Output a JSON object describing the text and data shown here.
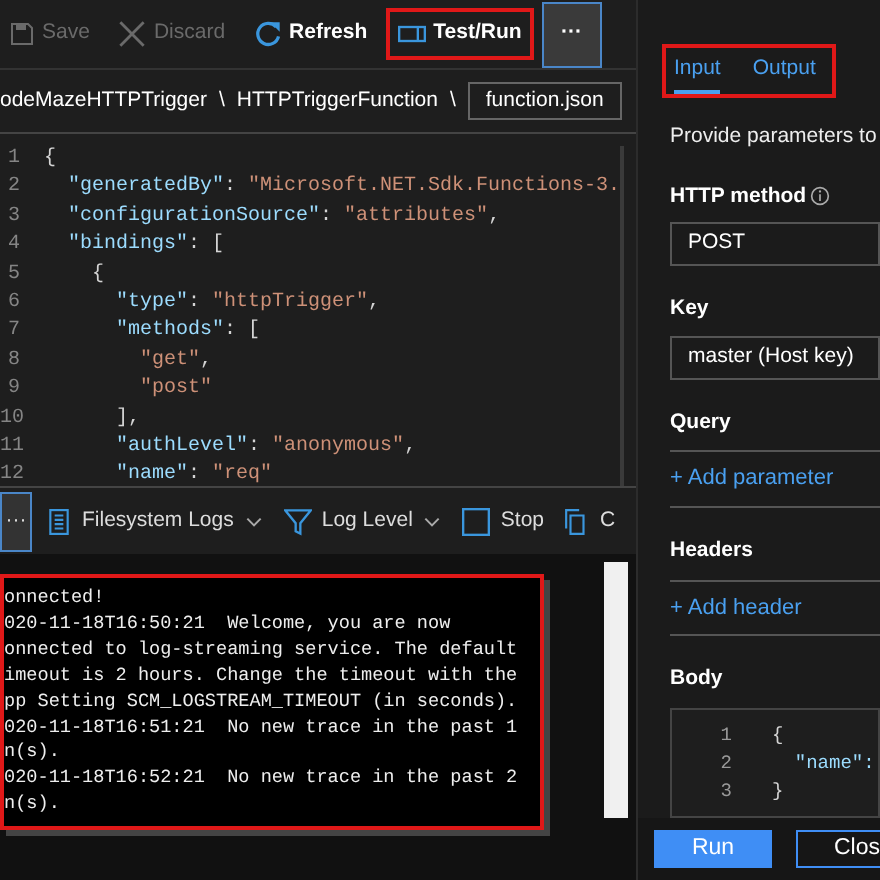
{
  "toolbar": [
    {
      "kind": "save",
      "label": "Save",
      "disabled": true,
      "highlighted": false
    },
    {
      "kind": "discard",
      "label": "Discard",
      "disabled": true,
      "highlighted": false
    },
    {
      "kind": "refresh",
      "label": "Refresh",
      "disabled": false,
      "highlighted": false
    },
    {
      "kind": "testrun",
      "label": "Test/Run",
      "disabled": false,
      "highlighted": true
    },
    {
      "kind": "more",
      "label": "···",
      "disabled": false,
      "highlighted": false,
      "focused": true
    }
  ],
  "breadcrumb": [
    {
      "kind": "segment",
      "text": "odeMazeHTTPTrigger"
    },
    {
      "kind": "separator",
      "text": "\\"
    },
    {
      "kind": "segment",
      "text": "HTTPTriggerFunction"
    },
    {
      "kind": "separator",
      "text": "\\"
    },
    {
      "kind": "file",
      "text": "function.json"
    }
  ],
  "editor": {
    "lines": [
      {
        "number": "1",
        "tokens": [
          {
            "kind": "punct",
            "text": "{"
          }
        ]
      },
      {
        "number": "2",
        "tokens": [
          {
            "kind": "key",
            "text": "  \"generatedBy\""
          },
          {
            "kind": "punct",
            "text": ": "
          },
          {
            "kind": "string",
            "text": "\"Microsoft.NET.Sdk.Functions-3."
          }
        ]
      },
      {
        "number": "3",
        "tokens": [
          {
            "kind": "key",
            "text": "  \"configurationSource\""
          },
          {
            "kind": "punct",
            "text": ": "
          },
          {
            "kind": "string",
            "text": "\"attributes\""
          },
          {
            "kind": "punct",
            "text": ","
          }
        ]
      },
      {
        "number": "4",
        "tokens": [
          {
            "kind": "key",
            "text": "  \"bindings\""
          },
          {
            "kind": "punct",
            "text": ": ["
          }
        ]
      },
      {
        "number": "5",
        "tokens": [
          {
            "kind": "punct",
            "text": "    {"
          }
        ]
      },
      {
        "number": "6",
        "tokens": [
          {
            "kind": "key",
            "text": "      \"type\""
          },
          {
            "kind": "punct",
            "text": ": "
          },
          {
            "kind": "string",
            "text": "\"httpTrigger\""
          },
          {
            "kind": "punct",
            "text": ","
          }
        ]
      },
      {
        "number": "7",
        "tokens": [
          {
            "kind": "key",
            "text": "      \"methods\""
          },
          {
            "kind": "punct",
            "text": ": ["
          }
        ]
      },
      {
        "number": "8",
        "tokens": [
          {
            "kind": "string",
            "text": "        \"get\""
          },
          {
            "kind": "punct",
            "text": ","
          }
        ]
      },
      {
        "number": "9",
        "tokens": [
          {
            "kind": "string",
            "text": "        \"post\""
          }
        ]
      },
      {
        "number": "10",
        "tokens": [
          {
            "kind": "punct",
            "text": "      ],"
          }
        ]
      },
      {
        "number": "11",
        "tokens": [
          {
            "kind": "key",
            "text": "      \"authLevel\""
          },
          {
            "kind": "punct",
            "text": ": "
          },
          {
            "kind": "string",
            "text": "\"anonymous\""
          },
          {
            "kind": "punct",
            "text": ","
          }
        ]
      },
      {
        "number": "12",
        "tokens": [
          {
            "kind": "key",
            "text": "      \"name\""
          },
          {
            "kind": "punct",
            "text": ": "
          },
          {
            "kind": "string",
            "text": "\"req\""
          }
        ]
      }
    ]
  },
  "log_toolbar": [
    {
      "kind": "more",
      "label": "···",
      "dropdown": false,
      "focused": true
    },
    {
      "kind": "filesystem",
      "label": "Filesystem Logs",
      "dropdown": true,
      "focused": false
    },
    {
      "kind": "loglevel",
      "label": "Log Level",
      "dropdown": true,
      "focused": false
    },
    {
      "kind": "stop",
      "label": "Stop",
      "dropdown": false,
      "focused": false
    },
    {
      "kind": "copy",
      "label": "C",
      "dropdown": false,
      "focused": false
    }
  ],
  "log": {
    "highlighted": true,
    "lines": [
      "onnected!",
      "020-11-18T16:50:21  Welcome, you are now",
      "onnected to log-streaming service. The default",
      "imeout is 2 hours. Change the timeout with the",
      "pp Setting SCM_LOGSTREAM_TIMEOUT (in seconds).",
      "020-11-18T16:51:21  No new trace in the past 1",
      "n(s).",
      "020-11-18T16:52:21  No new trace in the past 2",
      "n(s)."
    ]
  },
  "test_panel": {
    "tabs_highlighted": true,
    "tabs": [
      {
        "label": "Input",
        "selected": true
      },
      {
        "label": "Output",
        "selected": false
      }
    ],
    "intro": "Provide parameters to",
    "fields": [
      {
        "kind": "select",
        "label": "HTTP method",
        "info": true,
        "value": "POST"
      },
      {
        "kind": "select",
        "label": "Key",
        "info": false,
        "value": "master (Host key)"
      },
      {
        "kind": "link",
        "label": "Query",
        "link": "+ Add parameter"
      },
      {
        "kind": "link",
        "label": "Headers",
        "link": "+ Add header"
      },
      {
        "kind": "code",
        "label": "Body",
        "lines": [
          {
            "number": "1",
            "kind": "punct",
            "text": "{"
          },
          {
            "number": "2",
            "kind": "key",
            "text": "  \"name\":"
          },
          {
            "number": "3",
            "kind": "punct",
            "text": "}"
          }
        ]
      }
    ],
    "buttons": [
      {
        "kind": "primary",
        "label": "Run"
      },
      {
        "kind": "secondary",
        "label": "Clos"
      }
    ]
  }
}
